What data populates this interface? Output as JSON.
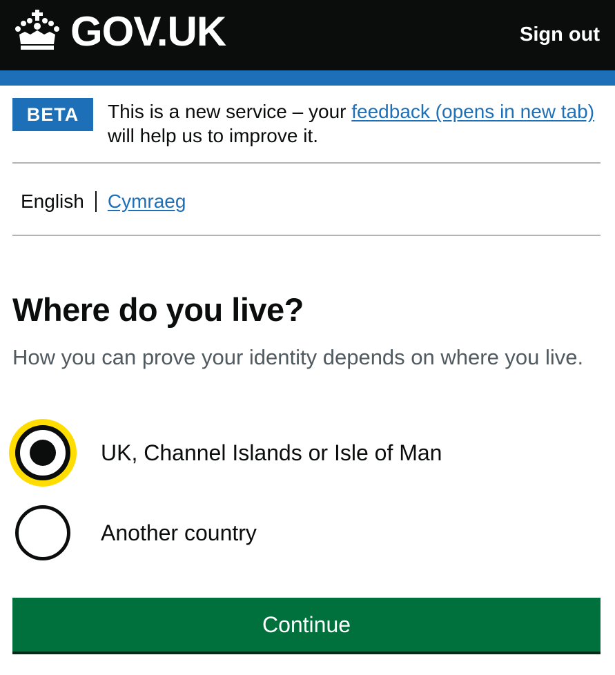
{
  "header": {
    "logo_text": "GOV.UK",
    "logo_icon": "crown-icon",
    "sign_out": "Sign out"
  },
  "phase_banner": {
    "tag": "BETA",
    "text_before": "This is a new service – your ",
    "link_text": "feedback (opens in new tab)",
    "text_after": " will help us to improve it."
  },
  "language": {
    "current": "English",
    "alternate": "Cymraeg"
  },
  "question": {
    "title": "Where do you live?",
    "hint": "How you can prove your identity depends on where you live."
  },
  "options": [
    {
      "label": "UK, Channel Islands or Isle of Man",
      "selected": true
    },
    {
      "label": "Another country",
      "selected": false
    }
  ],
  "continue_label": "Continue",
  "colors": {
    "header_bg": "#0b0c0c",
    "brand_blue": "#1d70b8",
    "focus_yellow": "#ffdd00",
    "button_green": "#00703c"
  }
}
